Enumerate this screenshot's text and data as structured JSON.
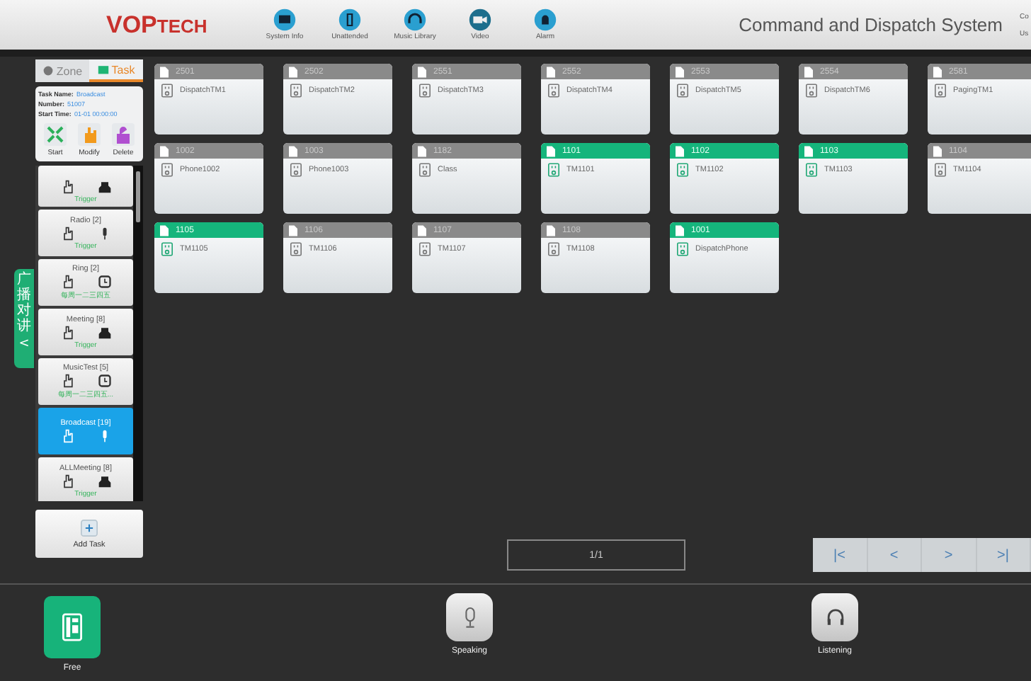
{
  "header": {
    "logo": {
      "main": "VOP",
      "rest": "TECH"
    },
    "nav": [
      {
        "label": "System Info",
        "kind": "monitor"
      },
      {
        "label": "Unattended",
        "kind": "phone"
      },
      {
        "label": "Music Library",
        "kind": "headphones"
      },
      {
        "label": "Video",
        "kind": "camera"
      },
      {
        "label": "Alarm",
        "kind": "alarm"
      }
    ],
    "title": "Command and Dispatch System",
    "cut_lines": [
      "Co",
      "Us"
    ]
  },
  "side_tab": {
    "label": "广播对讲",
    "arrow": "<"
  },
  "left_tabs": [
    {
      "label": "Zone",
      "selected": false
    },
    {
      "label": "Task",
      "selected": true
    }
  ],
  "task_info": {
    "fields": [
      {
        "label": "Task Name:",
        "value": "Broadcast"
      },
      {
        "label": "Number:",
        "value": "51007"
      },
      {
        "label": "Start Time:",
        "value": "01-01 00:00:00"
      }
    ],
    "actions": [
      {
        "label": "Start",
        "kind": "start"
      },
      {
        "label": "Modify",
        "kind": "modify"
      },
      {
        "label": "Delete",
        "kind": "delete"
      }
    ]
  },
  "tasks": [
    {
      "kind": "building",
      "schedule": "Trigger",
      "selected": false
    },
    {
      "name": "Radio [2]",
      "kind": "mic",
      "schedule": "Trigger",
      "selected": false
    },
    {
      "name": "Ring [2]",
      "kind": "clock",
      "schedule": "每周一二三四五",
      "selected": false
    },
    {
      "name": "Meeting [8]",
      "kind": "building",
      "schedule": "Trigger",
      "selected": false
    },
    {
      "name": "MusicTest [5]",
      "kind": "clock",
      "schedule": "每周一二三四五...",
      "selected": false
    },
    {
      "name": "Broadcast [19]",
      "kind": "mic",
      "selected": true
    },
    {
      "name": "ALLMeeting [8]",
      "kind": "building",
      "schedule": "Trigger",
      "selected": false
    }
  ],
  "add_task": "Add Task",
  "terminals": [
    {
      "number": "2501",
      "name": "DispatchTM1",
      "online": false
    },
    {
      "number": "2502",
      "name": "DispatchTM2",
      "online": false
    },
    {
      "number": "2551",
      "name": "DispatchTM3",
      "online": false
    },
    {
      "number": "2552",
      "name": "DispatchTM4",
      "online": false
    },
    {
      "number": "2553",
      "name": "DispatchTM5",
      "online": false
    },
    {
      "number": "2554",
      "name": "DispatchTM6",
      "online": false
    },
    {
      "number": "2581",
      "name": "PagingTM1",
      "online": false
    },
    {
      "number": "1002",
      "name": "Phone1002",
      "online": false
    },
    {
      "number": "1003",
      "name": "Phone1003",
      "online": false
    },
    {
      "number": "1182",
      "name": "Class",
      "online": false
    },
    {
      "number": "1101",
      "name": "TM1101",
      "online": true
    },
    {
      "number": "1102",
      "name": "TM1102",
      "online": true
    },
    {
      "number": "1103",
      "name": "TM1103",
      "online": true
    },
    {
      "number": "1104",
      "name": "TM1104",
      "online": false
    },
    {
      "number": "1105",
      "name": "TM1105",
      "online": true
    },
    {
      "number": "1106",
      "name": "TM1106",
      "online": false
    },
    {
      "number": "1107",
      "name": "TM1107",
      "online": false
    },
    {
      "number": "1108",
      "name": "TM1108",
      "online": false
    },
    {
      "number": "1001",
      "name": "DispatchPhone",
      "online": true
    }
  ],
  "pager": {
    "page": "1/1",
    "buttons": [
      "|<",
      "<",
      ">",
      ">|"
    ]
  },
  "bottom": {
    "status": "Free",
    "actions": [
      {
        "label": "Speaking",
        "kind": "mic"
      },
      {
        "label": "Listening",
        "kind": "headset"
      }
    ]
  }
}
